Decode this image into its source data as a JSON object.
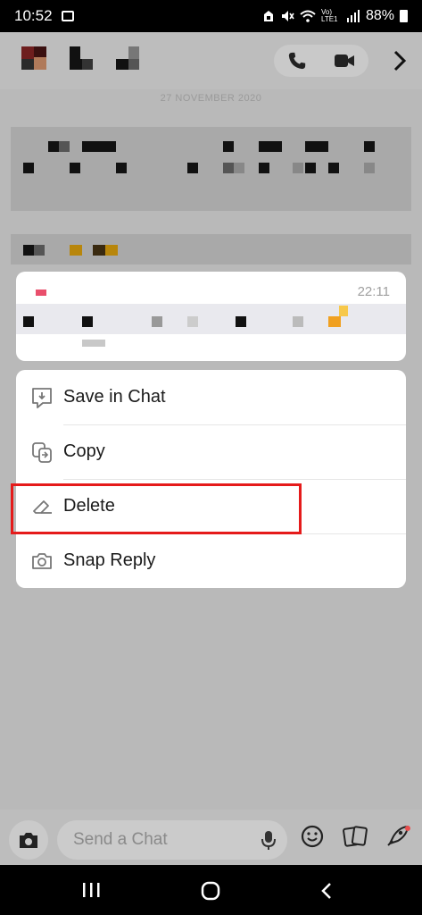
{
  "status_bar": {
    "time": "10:52",
    "network": "Vo) LTE1",
    "battery": "88%"
  },
  "chat": {
    "date_separator": "27 NOVEMBER 2020"
  },
  "message": {
    "time": "22:11"
  },
  "context_menu": {
    "items": [
      {
        "label": "Save in Chat",
        "icon": "save-in-chat-icon"
      },
      {
        "label": "Copy",
        "icon": "copy-icon"
      },
      {
        "label": "Delete",
        "icon": "eraser-icon"
      },
      {
        "label": "Snap Reply",
        "icon": "camera-icon"
      }
    ]
  },
  "composer": {
    "placeholder": "Send a Chat"
  },
  "colors": {
    "highlight": "#e51b1b",
    "accent_red": "#e94f6c",
    "dim_overlay": "#b9b9b9"
  }
}
